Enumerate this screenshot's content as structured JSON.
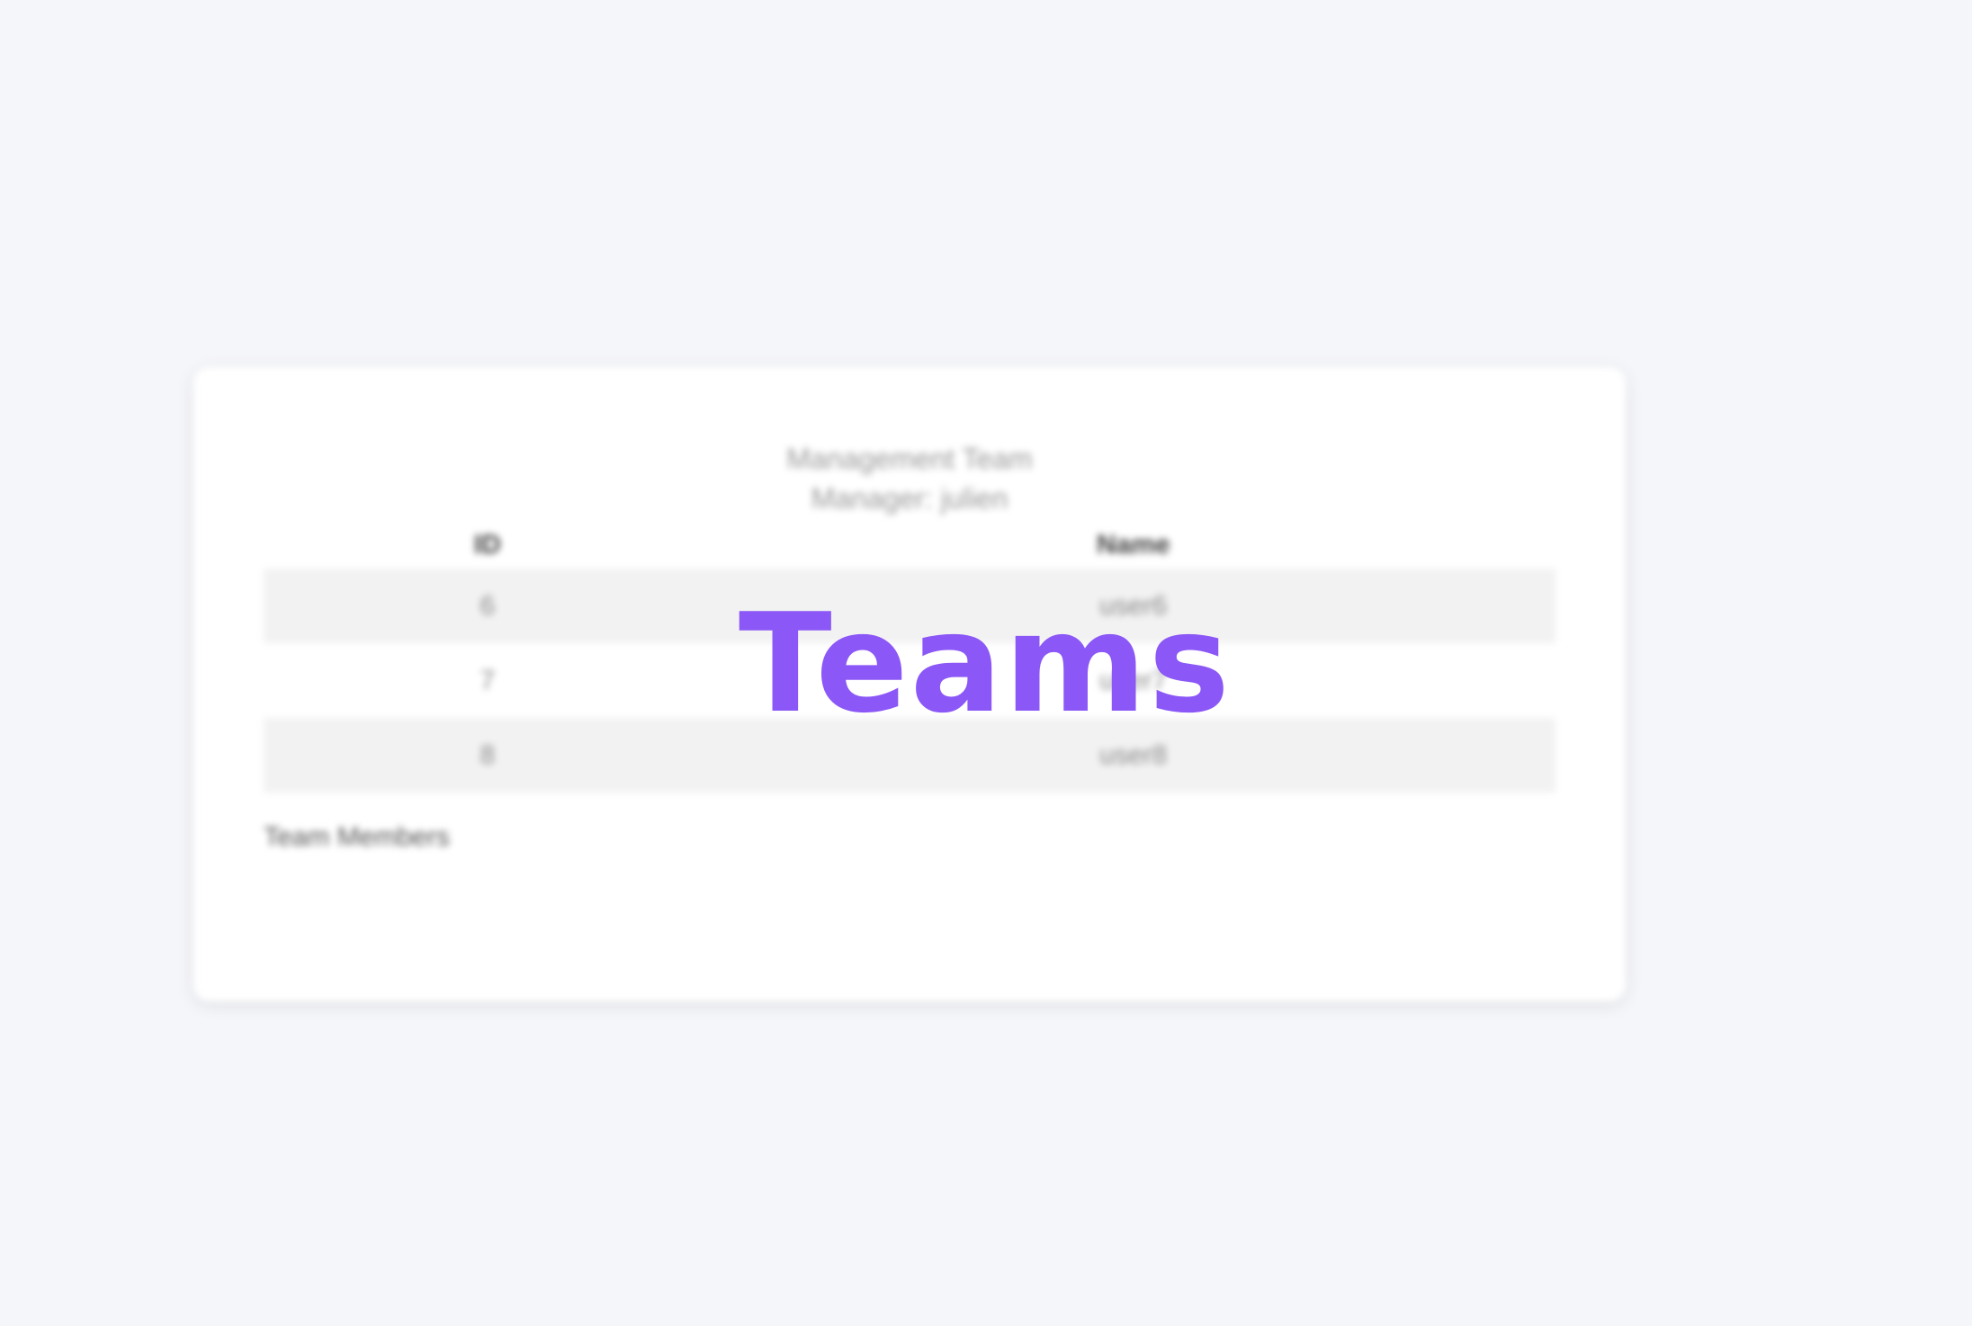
{
  "colors": {
    "page_background": "#f5f6fa",
    "card_background": "#ffffff",
    "accent": "#8b57f6",
    "row_stripe": "#f2f2f2"
  },
  "overlay": {
    "title": "Teams"
  },
  "team_card": {
    "team_name": "Management Team",
    "manager_line": "Manager: julien",
    "table": {
      "headers": [
        "ID",
        "Name"
      ],
      "rows": [
        {
          "id": "6",
          "name": "user6"
        },
        {
          "id": "7",
          "name": "user7"
        },
        {
          "id": "8",
          "name": "user8"
        }
      ]
    },
    "caption": "Team Members"
  }
}
